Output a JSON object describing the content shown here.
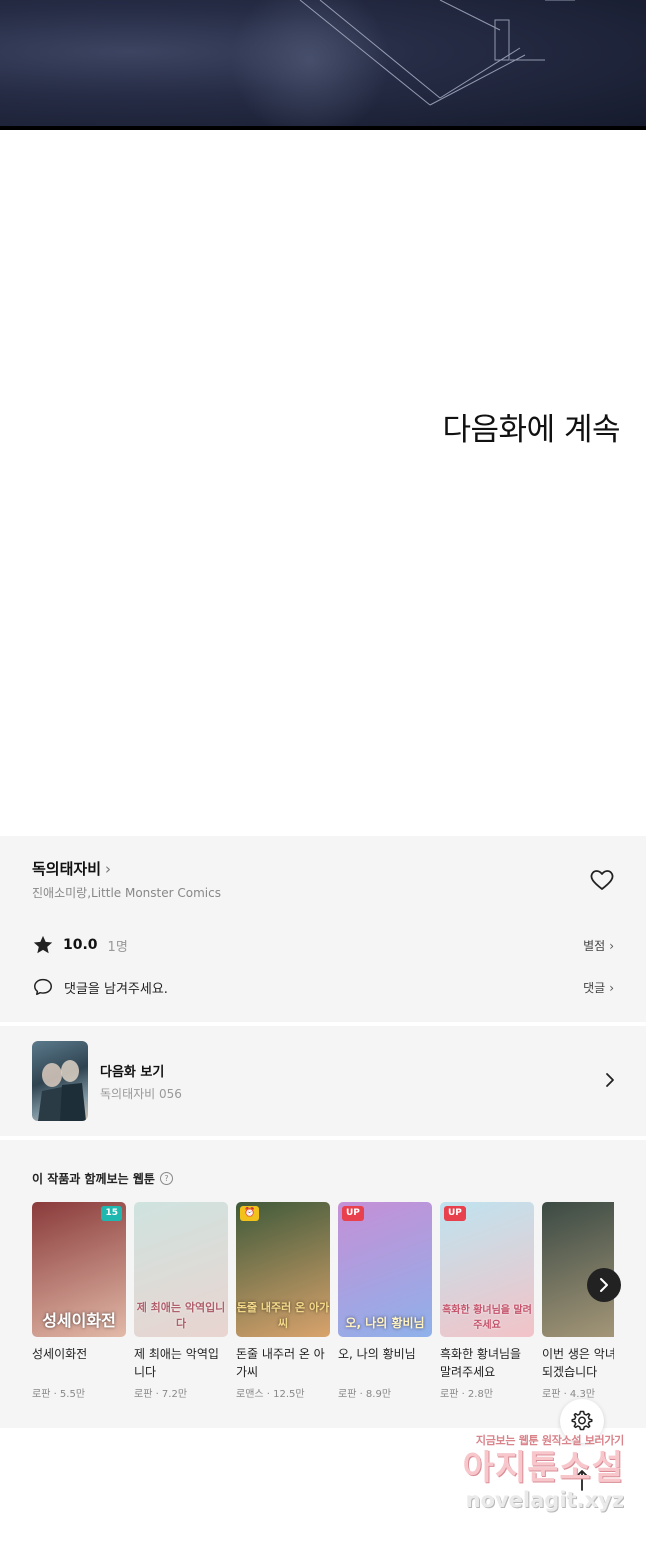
{
  "page": {
    "continue_text": "다음화에 계속"
  },
  "series": {
    "title": "독의태자비",
    "title_chevron": "›",
    "authors": "진애소미랑,Little Monster Comics",
    "rating_score": "10.0",
    "rating_count": "1명",
    "rating_link": "별점",
    "comment_prompt": "댓글을 남겨주세요.",
    "comment_link": "댓글",
    "link_chevron": "›"
  },
  "next_episode": {
    "label": "다음화 보기",
    "subtitle": "독의태자비 056"
  },
  "recommendations": {
    "title": "이 작품과 함께보는 웹툰",
    "help": "?",
    "items": [
      {
        "title": "성세이화전",
        "meta": "로판 · 5.5만",
        "badge": "15",
        "badge_color": "#1fb8b0",
        "cover_text": "성세이화전",
        "cover_colors": [
          "#8a3b3b",
          "#e2b9a8"
        ]
      },
      {
        "title": "제 최애는 악역입니다",
        "meta": "로판 · 7.2만",
        "badge": "",
        "badge_color": "",
        "cover_text": "제 최애는 악역입니다",
        "cover_colors": [
          "#cfe3df",
          "#e9d4d0"
        ]
      },
      {
        "title": "돈줄 내주러 온 아가씨",
        "meta": "로맨스 · 12.5만",
        "badge": "⏰",
        "badge_color": "#f2c21b",
        "cover_text": "돈줄 내주러 온 아가씨",
        "cover_colors": [
          "#3f5a3a",
          "#d9a36c"
        ]
      },
      {
        "title": "오, 나의 황비님",
        "meta": "로판 · 8.9만",
        "badge": "UP",
        "badge_color": "#e8404c",
        "cover_text": "오, 나의 황비님",
        "cover_colors": [
          "#c58fd6",
          "#8fb1ea"
        ]
      },
      {
        "title": "흑화한 황녀님을 말려주세요",
        "meta": "로판 · 2.8만",
        "badge": "UP",
        "badge_color": "#e8404c",
        "cover_text": "흑화한 황녀님을 말려주세요",
        "cover_colors": [
          "#bfe3ef",
          "#f2c3c7"
        ]
      },
      {
        "title": "이번 생은 악녀로 되겠습니다",
        "meta": "로판 · 4.3만",
        "badge": "",
        "badge_color": "",
        "cover_text": "",
        "cover_colors": [
          "#3b4a44",
          "#a99a7a"
        ]
      }
    ]
  },
  "watermark": {
    "tagline": "지금보는 웹툰 원작소설 보러가기",
    "brand": "아지툰소설",
    "url": "novelagit.xyz"
  },
  "icons": {
    "heart": "heart-icon",
    "star": "star-icon",
    "comment": "comment-bubble-icon",
    "settings": "gear-icon",
    "scroll_top": "arrow-up-icon",
    "carousel_next": "chevron-right-icon"
  }
}
